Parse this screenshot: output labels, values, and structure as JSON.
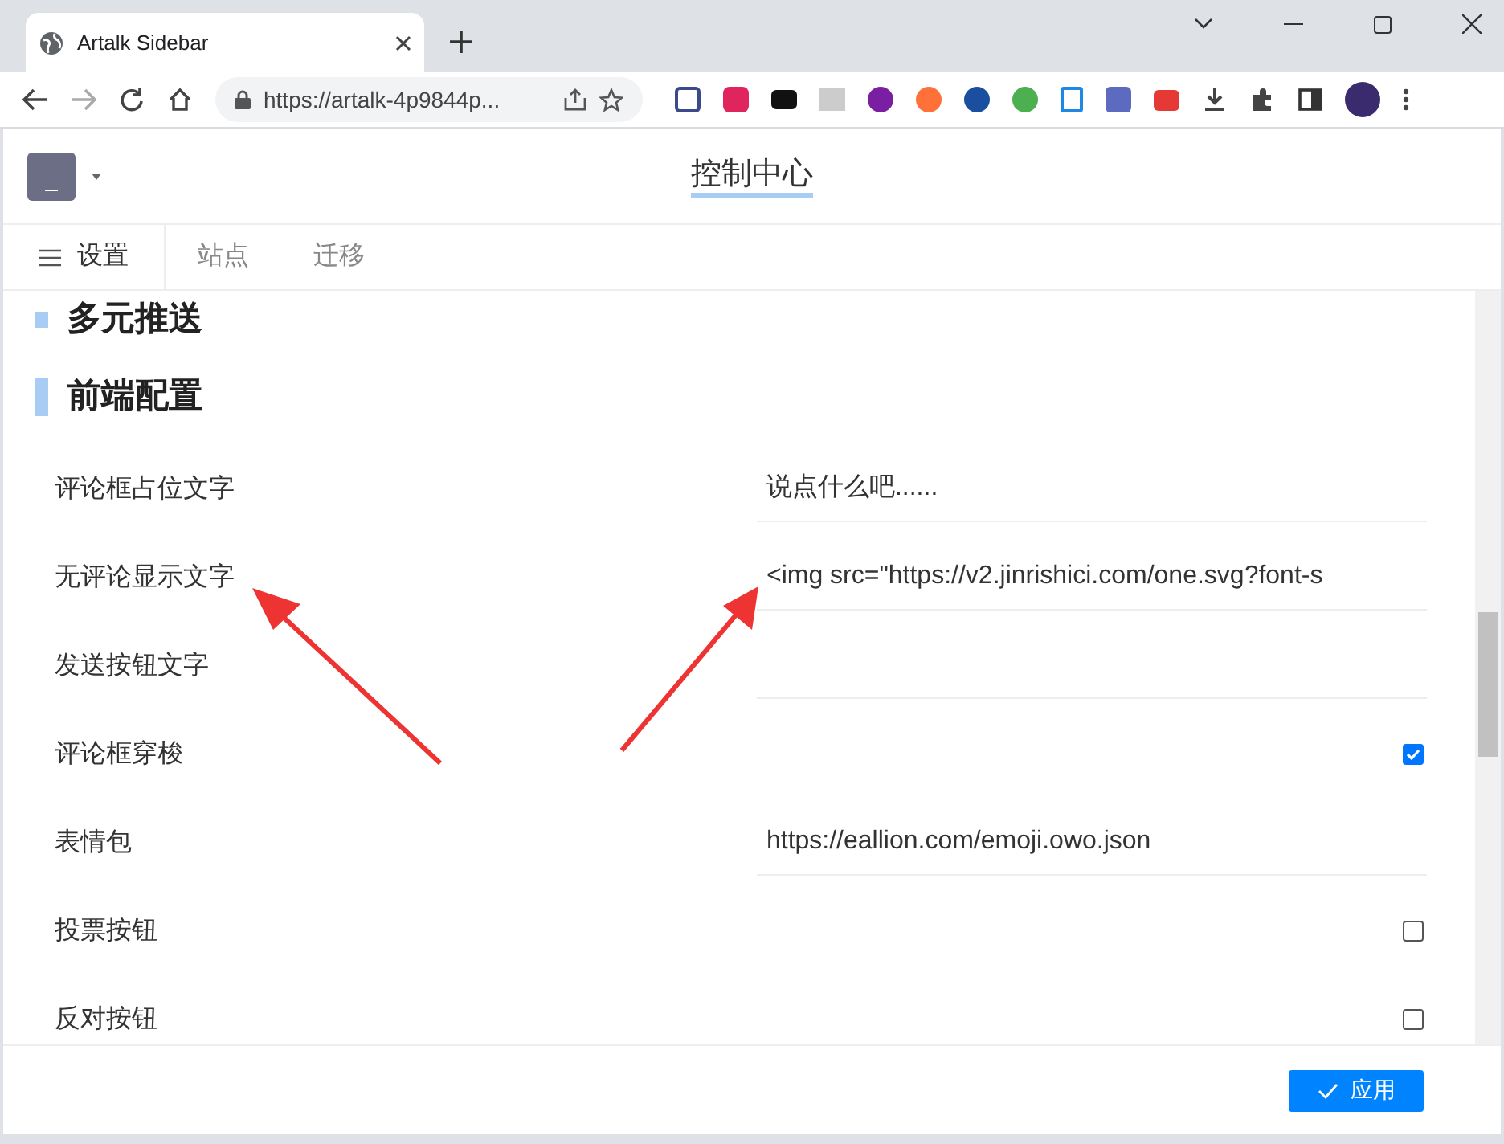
{
  "browser": {
    "tab_title": "Artalk Sidebar",
    "url": "https://artalk-4p9844p..."
  },
  "header": {
    "title": "控制中心"
  },
  "nav_tabs": [
    {
      "label": "设置",
      "selected": true
    },
    {
      "label": "站点",
      "selected": false
    },
    {
      "label": "迁移",
      "selected": false
    }
  ],
  "sections": [
    {
      "title": "多元推送"
    },
    {
      "title": "前端配置",
      "rows": [
        {
          "kind": "text",
          "label": "评论框占位文字",
          "value": "说点什么吧......"
        },
        {
          "kind": "text",
          "label": "无评论显示文字",
          "value": "<img src=\"https://v2.jinrishici.com/one.svg?font-s"
        },
        {
          "kind": "text",
          "label": "发送按钮文字",
          "value": ""
        },
        {
          "kind": "checkbox",
          "label": "评论框穿梭",
          "checked": true
        },
        {
          "kind": "text",
          "label": "表情包",
          "value": "https://eallion.com/emoji.owo.json"
        },
        {
          "kind": "checkbox",
          "label": "投票按钮",
          "checked": false
        },
        {
          "kind": "checkbox",
          "label": "反对按钮",
          "checked": false
        }
      ]
    }
  ],
  "footer": {
    "button": "应用"
  }
}
